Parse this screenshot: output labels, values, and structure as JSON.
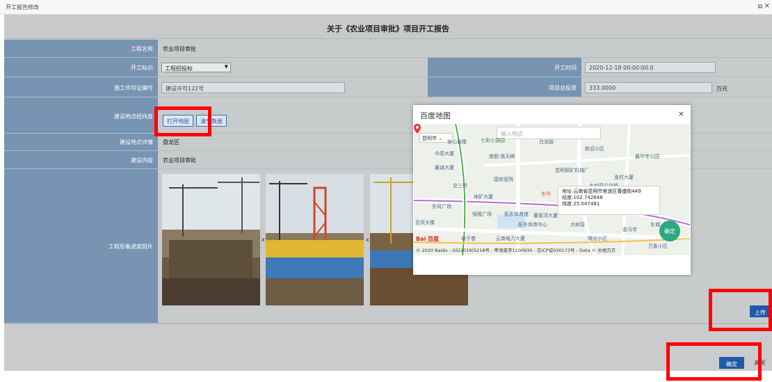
{
  "window": {
    "title": "开工报告修改"
  },
  "header": {
    "title": "关于《农业项目审批》项目开工报告"
  },
  "form": {
    "project_name": {
      "label": "工程名称",
      "value": "农业项目审批"
    },
    "start_flag": {
      "label": "开工标识",
      "value": "工程招投标"
    },
    "start_time": {
      "label": "开工时间",
      "value": "2020-12-18 00:00:00.0"
    },
    "permit_no": {
      "label": "施工许可证编号",
      "value": "建设许可122号"
    },
    "total_investment": {
      "label": "项目总投资",
      "value": "333.0000",
      "unit": "万元"
    },
    "coords": {
      "label": "建设地点经纬度",
      "open_map": "打开地图",
      "clear_data": "清空数据"
    },
    "location_detail": {
      "label": "建设地点详情",
      "value": "盘龙区"
    },
    "content": {
      "label": "建设内容",
      "value": "农业项目审批"
    },
    "photos": {
      "label": "工程形象进度照片",
      "remove": "x"
    }
  },
  "buttons": {
    "upload": "上传",
    "confirm": "确定",
    "close": "关闭"
  },
  "map_dialog": {
    "title": "百度地图",
    "search_placeholder": "输入地点",
    "city": "昆明市",
    "info": {
      "address": "地址:云南省昆明市官渡区春盛街449",
      "longitude": "经度:102.742648",
      "latitude": "纬度:25.047481"
    },
    "confirm": "确定",
    "logo": "Bai 百度",
    "copyright": "© 2020 Baidu - GS(2019)5218号 - 甲测资字1100930 - 京ICP证030173号 - Data © 长地万方",
    "pois": {
      "p1": "穿心鼓楼",
      "p2": "七彩小游园",
      "p3": "白龙路",
      "p4": "新迎小区",
      "p5": "中原大厦",
      "p6": "度假·逸天峰",
      "p7": "昆明探矿机械厂",
      "p8": "鑫华寺公园",
      "p9": "鑫诚大厦",
      "p10": "国安医院",
      "p11": "交三桥",
      "p12": "金村大厦",
      "p13": "大树营立交桥",
      "p14": "东华",
      "p15": "地矿大厦",
      "p16": "东风广场",
      "p17": "恒隆广场",
      "p18": "拓东体育馆",
      "p19": "董家湾大厦",
      "p20": "百货大楼",
      "p21": "拓东体育中心",
      "p22": "大树营",
      "p23": "金马寺",
      "p24": "塘子巷",
      "p25": "云南电力大厦",
      "p26": "曙光小区",
      "p27": "东城",
      "p28": "万象小区"
    }
  }
}
